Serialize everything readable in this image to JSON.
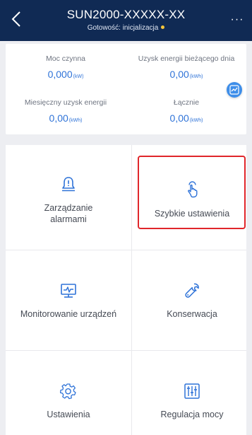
{
  "header": {
    "title": "SUN2000-XXXXX-XX",
    "subtitle": "Gotowość: inicjalizacja",
    "more_label": "···"
  },
  "energy": {
    "items": [
      {
        "label": "Moc czynna",
        "value": "0,000",
        "unit": "(kW)"
      },
      {
        "label": "Uzysk energii bieżącego dnia",
        "value": "0,00",
        "unit": "(kWh)"
      },
      {
        "label": "Miesięczny uzysk energii",
        "value": "0,00",
        "unit": "(kWh)"
      },
      {
        "label": "Łącznie",
        "value": "0,00",
        "unit": "(kWh)"
      }
    ]
  },
  "menu": {
    "items": [
      {
        "label": "Zarządzanie alarmami",
        "icon": "alarm-bell-icon"
      },
      {
        "label": "Szybkie ustawienia",
        "icon": "tap-hand-icon"
      },
      {
        "label": "Monitorowanie urządzeń",
        "icon": "monitor-icon"
      },
      {
        "label": "Konserwacja",
        "icon": "wrench-icon"
      },
      {
        "label": "Ustawienia",
        "icon": "gear-icon"
      },
      {
        "label": "Regulacja mocy",
        "icon": "sliders-icon"
      }
    ]
  },
  "colors": {
    "header_bg": "#102a54",
    "accent_blue": "#2f73d8",
    "highlight_red": "#e0262b",
    "status_dot": "#f7c63b"
  }
}
